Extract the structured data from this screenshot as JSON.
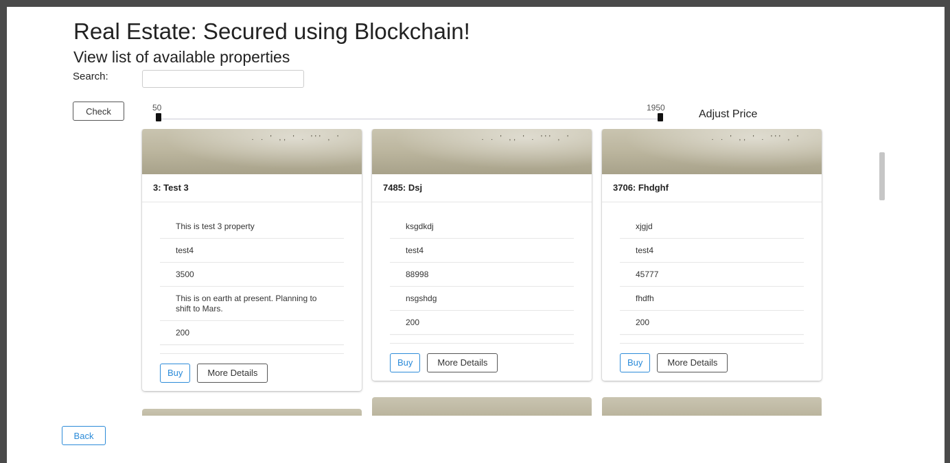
{
  "header": {
    "title": "Real Estate: Secured using Blockchain!",
    "subtitle": "View list of available properties"
  },
  "search": {
    "label": "Search:",
    "value": "",
    "placeholder": ""
  },
  "check_button": "Check",
  "price_slider": {
    "min_label": "50",
    "max_label": "1950",
    "label": "Adjust Price",
    "min": 50,
    "max": 1950
  },
  "properties": [
    {
      "heading": "3: Test 3",
      "details": [
        "This is test 3 property",
        "test4",
        "3500",
        "This is on earth at present. Planning to shift to Mars.",
        "200"
      ],
      "buy_label": "Buy",
      "more_label": "More Details"
    },
    {
      "heading": "7485: Dsj",
      "details": [
        "ksgdkdj",
        "test4",
        "88998",
        "nsgshdg",
        "200"
      ],
      "buy_label": "Buy",
      "more_label": "More Details"
    },
    {
      "heading": "3706: Fhdghf",
      "details": [
        "xjgjd",
        "test4",
        "45777",
        "fhdfh",
        "200"
      ],
      "buy_label": "Buy",
      "more_label": "More Details"
    }
  ],
  "back_button": "Back",
  "colors": {
    "accent": "#2a8ad8",
    "frame": "#4a4a4a"
  }
}
